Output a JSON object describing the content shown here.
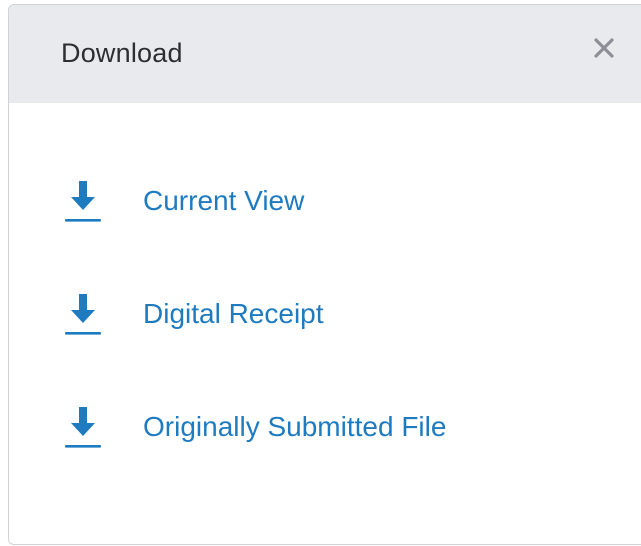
{
  "dialog": {
    "title": "Download",
    "close_icon": "close-icon",
    "accent_color": "#1f7bc0",
    "items": [
      {
        "label": "Current View",
        "icon": "download-icon"
      },
      {
        "label": "Digital Receipt",
        "icon": "download-icon"
      },
      {
        "label": "Originally Submitted File",
        "icon": "download-icon"
      }
    ]
  }
}
